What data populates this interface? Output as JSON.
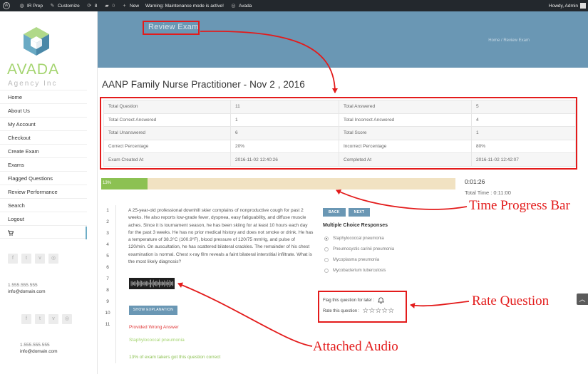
{
  "adminbar": {
    "site_name": "IR Prep",
    "customize": "Customize",
    "updates_count": "8",
    "comments_count": "0",
    "new_label": "New",
    "warning": "Warning: Maintenance mode is active!",
    "avada_label": "Avada",
    "howdy": "Howdy, Admin"
  },
  "logo": {
    "name": "AVADA",
    "tagline": "Agency Inc",
    "colors": {
      "top": "#b0d989",
      "left": "#6aaac4",
      "right": "#4a88a8",
      "center": "#5d8fb0"
    }
  },
  "sidebar": {
    "items": [
      {
        "label": "Home"
      },
      {
        "label": "About Us"
      },
      {
        "label": "My Account"
      },
      {
        "label": "Checkout"
      },
      {
        "label": "Create Exam"
      },
      {
        "label": "Exams"
      },
      {
        "label": "Flagged Questions"
      },
      {
        "label": "Review Performance"
      },
      {
        "label": "Search"
      },
      {
        "label": "Logout"
      }
    ],
    "cart_icon": "cart-icon",
    "social_icons": [
      "facebook-icon",
      "twitter-icon",
      "vimeo-icon",
      "instagram-icon"
    ],
    "phone": "1.555.555.555",
    "email": "info@domain.com"
  },
  "header": {
    "page_title": "Review Exam",
    "breadcrumb_home": "Home",
    "breadcrumb_sep": "/",
    "breadcrumb_current": "Review Exam",
    "band_color": "#6a97b4"
  },
  "exam": {
    "title": "AANP Family Nurse Practitioner - Nov 2 , 2016"
  },
  "stats": {
    "rows": [
      [
        "Total Question",
        "11",
        "Total Answered",
        "5"
      ],
      [
        "Total Correct Answered",
        "1",
        "Total Incorrect Answered",
        "4"
      ],
      [
        "Total Unanswered",
        "6",
        "Total Score",
        "1"
      ],
      [
        "Correct Percentage",
        "20%",
        "Incorrect Percentage",
        "80%"
      ],
      [
        "Exam Created At",
        "2016-11-02 12:40:26",
        "Completed At",
        "2016-11-02 12:42:07"
      ]
    ]
  },
  "progress": {
    "label": "13%",
    "fraction": 0.13,
    "fill_color": "#8cc152",
    "track_color": "#f1e2c2",
    "elapsed": "0:01:26",
    "total_time": "Total Time : 0:11:00"
  },
  "question_numbers": [
    "1",
    "2",
    "3",
    "4",
    "5",
    "6",
    "7",
    "8",
    "9",
    "10",
    "11"
  ],
  "question": {
    "text": "A 25-year-old professional downhill skier complains of nonproductive cough for past 2 weeks. He also reports low-grade fever, dyspnea, easy fatiguability, and diffuse muscle aches. Since it is tournament season, he has been skiing for at least 10 hours each day for the past 3 weeks. He has no prior medical history and does not smoke or drink. He has a temperature of 38.3°C (100.9°F), blood pressure of 120/75 mmHg, and pulse of 120/min. On auscultation, he has scattered bilateral crackles. The remainder of his chest examination is normal. Chest x-ray film reveals a faint bilateral interstitial infiltrate. What is the most likely diagnosis?",
    "show_explanation": "SHOW EXPLANATION",
    "wrong_label": "Provided Wrong Answer",
    "correct_answer": "Staphylococcal pneumonia",
    "percent_correct": "13% of exam takers got this question correct"
  },
  "controls": {
    "back": "BACK",
    "next": "NEXT"
  },
  "responses": {
    "title": "Multiple Choice Responses",
    "options": [
      {
        "label": "Staphylococcal pneumonia",
        "selected": true
      },
      {
        "label": "Pneumocystis carinii pneumonia",
        "selected": false
      },
      {
        "label": "Mycoplasma pneumonia",
        "selected": false
      },
      {
        "label": "Mycobacterium tuberculosis",
        "selected": false
      }
    ]
  },
  "rating": {
    "flag_label": "Flag this question for later :",
    "rate_label": "Rate this question :",
    "stars_total": 5,
    "stars_filled": 0
  },
  "annotations": {
    "time_progress": "Time Progress Bar",
    "rate_question": "Rate Question",
    "attached_audio": "Attached Audio",
    "color": "#e31b1b"
  }
}
